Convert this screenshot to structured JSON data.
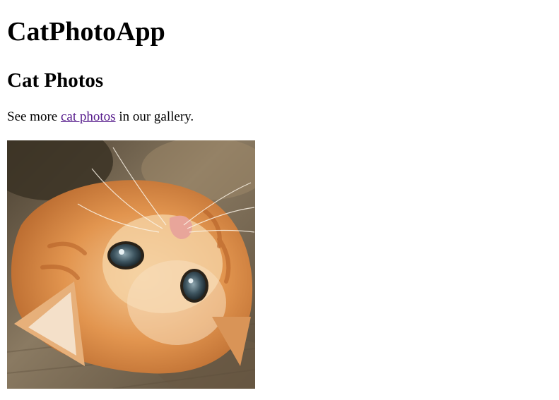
{
  "app": {
    "title": "CatPhotoApp"
  },
  "main": {
    "heading": "Cat Photos",
    "intro": {
      "before": "See more ",
      "link_text": "cat photos",
      "after": " in our gallery."
    },
    "image": {
      "icon": "kitten-photo",
      "colors": {
        "fur": "#e39a54",
        "fur_light": "#f7d9b0",
        "floor": "#7a6a52",
        "eye": "#3e5560",
        "nose": "#e8a59a"
      }
    }
  }
}
